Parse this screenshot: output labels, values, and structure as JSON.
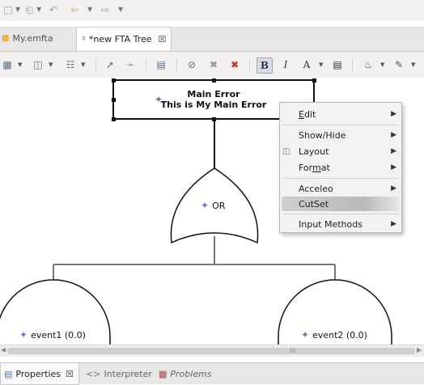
{
  "top_toolbar": {
    "icons": [
      "save-icon",
      "back-icon",
      "nav-back-icon",
      "nav-forward-icon"
    ]
  },
  "tabs": [
    {
      "label": "My.emfta",
      "active": false
    },
    {
      "label": "*new FTA Tree",
      "active": true
    }
  ],
  "diagram": {
    "root_title": "Main Error",
    "root_description": "This is My Main Error",
    "gate_label": "OR",
    "events": [
      {
        "label": "event1 (0.0)"
      },
      {
        "label": "event2 (0.0)"
      }
    ]
  },
  "context_menu": {
    "items": [
      {
        "label": "Edit",
        "mnemonic": "E",
        "submenu": true
      },
      {
        "label": "Show/Hide",
        "submenu": true
      },
      {
        "label": "Layout",
        "submenu": true
      },
      {
        "label": "Format",
        "mnemonic": "m",
        "submenu": true
      },
      {
        "label": "Acceleo",
        "submenu": true
      },
      {
        "label": "CutSet",
        "submenu": false,
        "highlighted": true
      },
      {
        "label": "Input Methods",
        "submenu": true
      }
    ]
  },
  "bottom_tabs": [
    {
      "label": "Properties",
      "active": true
    },
    {
      "label": "Interpreter",
      "active": false
    },
    {
      "label": "Problems",
      "active": false
    }
  ]
}
